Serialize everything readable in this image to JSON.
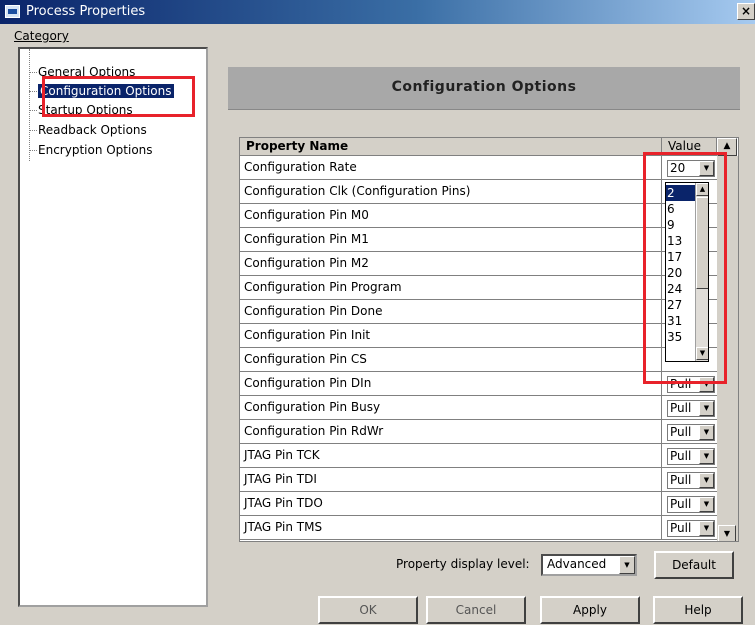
{
  "window": {
    "title": "Process Properties",
    "close_glyph": "×"
  },
  "category": {
    "label": "Category",
    "items": [
      {
        "label": "General Options"
      },
      {
        "label": "Configuration Options"
      },
      {
        "label": "Startup Options"
      },
      {
        "label": "Readback Options"
      },
      {
        "label": "Encryption Options"
      }
    ],
    "selected_index": 1
  },
  "main": {
    "heading": "Configuration Options",
    "table": {
      "header_name": "Property Name",
      "header_value": "Value",
      "rows": [
        {
          "name": "Configuration Rate",
          "value": "20"
        },
        {
          "name": "Configuration Clk (Configuration Pins)",
          "value": ""
        },
        {
          "name": "Configuration Pin M0",
          "value": ""
        },
        {
          "name": "Configuration Pin M1",
          "value": ""
        },
        {
          "name": "Configuration Pin M2",
          "value": ""
        },
        {
          "name": "Configuration Pin Program",
          "value": ""
        },
        {
          "name": "Configuration Pin Done",
          "value": ""
        },
        {
          "name": "Configuration Pin Init",
          "value": ""
        },
        {
          "name": "Configuration Pin CS",
          "value": ""
        },
        {
          "name": "Configuration Pin DIn",
          "value": "Pull"
        },
        {
          "name": "Configuration Pin Busy",
          "value": "Pull"
        },
        {
          "name": "Configuration Pin RdWr",
          "value": "Pull"
        },
        {
          "name": "JTAG Pin TCK",
          "value": "Pull"
        },
        {
          "name": "JTAG Pin TDI",
          "value": "Pull"
        },
        {
          "name": "JTAG Pin TDO",
          "value": "Pull"
        },
        {
          "name": "JTAG Pin TMS",
          "value": "Pull"
        }
      ]
    },
    "dropdown_options": [
      "2",
      "6",
      "9",
      "13",
      "17",
      "20",
      "24",
      "27",
      "31",
      "35"
    ],
    "dropdown_selected": "2"
  },
  "footer": {
    "display_level_label": "Property display level:",
    "display_level_value": "Advanced",
    "default_label": "Default",
    "ok_label": "OK",
    "cancel_label": "Cancel",
    "apply_label": "Apply",
    "help_label": "Help"
  },
  "colors": {
    "highlight": "#e8222a",
    "selection": "#0a246a",
    "window_bg": "#d4d0c8",
    "heading_bar": "#a8a8a8"
  }
}
